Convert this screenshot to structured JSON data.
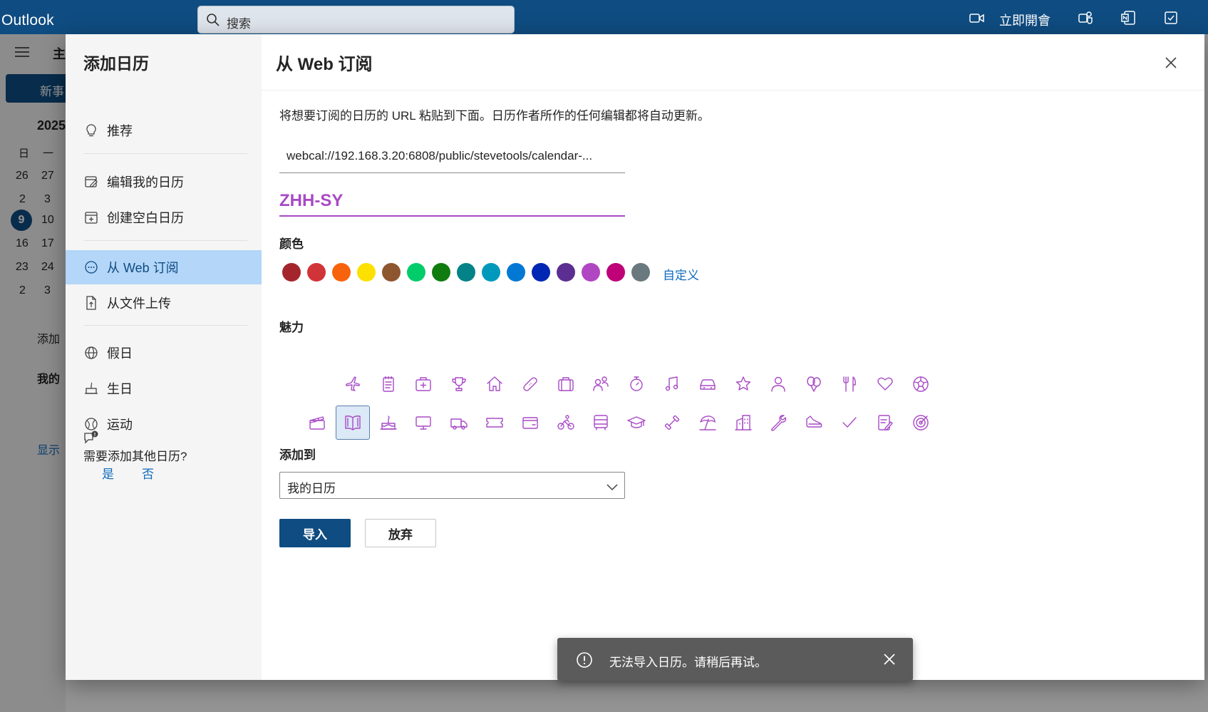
{
  "app": {
    "name": "Outlook"
  },
  "search": {
    "placeholder": "搜索"
  },
  "topbar": {
    "meet_now_label": "立即開會"
  },
  "background": {
    "nav_tab": "主",
    "new_event": "新事",
    "year": "2025",
    "weekdays": [
      "日",
      "一"
    ],
    "dates": [
      [
        "26",
        "27"
      ],
      [
        "2",
        "3"
      ],
      [
        "9",
        "10"
      ],
      [
        "16",
        "17"
      ],
      [
        "23",
        "24"
      ],
      [
        "2",
        "3"
      ]
    ],
    "add_calendar": "添加",
    "my_calendars": "我的",
    "show_all": "显示"
  },
  "dialog": {
    "sidebar": {
      "title": "添加日历",
      "items": [
        {
          "label": "推荐",
          "icon": "lightbulb-icon"
        },
        {
          "label": "编辑我的日历",
          "icon": "edit-calendar-icon"
        },
        {
          "label": "创建空白日历",
          "icon": "calendar-add-icon"
        },
        {
          "label": "从 Web 订阅",
          "icon": "web-subscribe-icon"
        },
        {
          "label": "从文件上传",
          "icon": "file-upload-icon"
        },
        {
          "label": "假日",
          "icon": "globe-icon"
        },
        {
          "label": "生日",
          "icon": "cake-icon"
        },
        {
          "label": "运动",
          "icon": "sports-ball-icon"
        }
      ],
      "footer": {
        "question": "需要添加其他日历?",
        "yes": "是",
        "no": "否"
      }
    },
    "main": {
      "title": "从 Web 订阅",
      "description": "将想要订阅的日历的 URL 粘贴到下面。日历作者所作的任何编辑都将自动更新。",
      "url_value": "webcal://192.168.3.20:6808/public/stevetools/calendar-...",
      "name_value": "ZHH-SY",
      "color_label": "颜色",
      "colors": [
        "#a4262c",
        "#d13438",
        "#f7630c",
        "#fce100",
        "#8e562e",
        "#00cc6a",
        "#107c10",
        "#038387",
        "#0099bc",
        "#0078d4",
        "#0027b4",
        "#5c2e91",
        "#b146c2",
        "#bf0077",
        "#69797e"
      ],
      "custom_color_label": "自定义",
      "charm_label": "魅力",
      "charm_color": "#a84ac5",
      "charms_row1": [
        "airplane-icon",
        "notepad-icon",
        "medical-kit-icon",
        "trophy-icon",
        "home-icon",
        "bandage-icon",
        "briefcase-icon",
        "people-icon",
        "stopwatch-icon",
        "music-note-icon",
        "car-icon",
        "star-icon",
        "person-icon",
        "balloons-icon",
        "fork-knife-icon",
        "heart-icon",
        "soccer-ball-icon"
      ],
      "charms_row2": [
        "clapperboard-icon",
        "book-icon",
        "birthday-cake-icon",
        "monitor-icon",
        "truck-icon",
        "ticket-icon",
        "wallet-icon",
        "cyclist-icon",
        "bus-icon",
        "graduation-cap-icon",
        "dumbbell-icon",
        "beach-umbrella-icon",
        "building-icon",
        "wrench-icon",
        "sneaker-icon",
        "checkmark-icon",
        "task-edit-icon",
        "target-icon"
      ],
      "selected_charm": "book-icon",
      "add_to_label": "添加到",
      "add_to_value": "我的日历",
      "import_button": "导入",
      "discard_button": "放弃"
    }
  },
  "toast": {
    "message": "无法导入日历。请稍后再试。"
  }
}
